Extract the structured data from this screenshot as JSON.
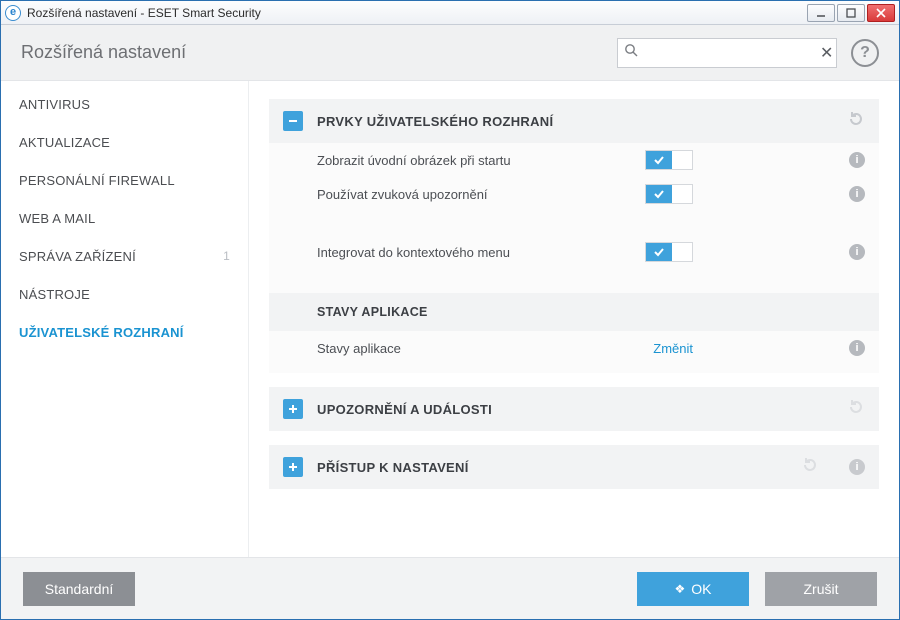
{
  "window": {
    "title": "Rozšířená nastavení - ESET Smart Security",
    "app_initial": "e"
  },
  "header": {
    "page_title": "Rozšířená nastavení",
    "search_placeholder": ""
  },
  "sidebar": {
    "items": [
      {
        "label": "ANTIVIRUS"
      },
      {
        "label": "AKTUALIZACE"
      },
      {
        "label": "PERSONÁLNÍ FIREWALL"
      },
      {
        "label": "WEB A MAIL"
      },
      {
        "label": "SPRÁVA ZAŘÍZENÍ",
        "badge": "1"
      },
      {
        "label": "NÁSTROJE"
      },
      {
        "label": "UŽIVATELSKÉ ROZHRANÍ"
      }
    ],
    "active_index": 6
  },
  "panels": {
    "ui_elements": {
      "title": "PRVKY UŽIVATELSKÉHO ROZHRANÍ",
      "rows": {
        "splash": {
          "label": "Zobrazit úvodní obrázek při startu",
          "on": true
        },
        "sounds": {
          "label": "Používat zvuková upozornění",
          "on": true
        },
        "context": {
          "label": "Integrovat do kontextového menu",
          "on": true
        }
      },
      "subheader": "STAVY APLIKACE",
      "status_row": {
        "label": "Stavy aplikace",
        "action": "Změnit"
      }
    },
    "notifications": {
      "title": "UPOZORNĚNÍ A UDÁLOSTI"
    },
    "access": {
      "title": "PŘÍSTUP K NASTAVENÍ"
    }
  },
  "footer": {
    "default": "Standardní",
    "ok": "OK",
    "cancel": "Zrušit"
  }
}
